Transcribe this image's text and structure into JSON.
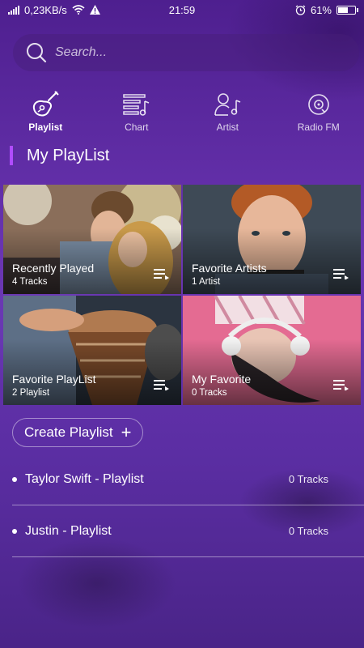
{
  "status_bar": {
    "speed": "0,23KB/s",
    "time": "21:59",
    "battery": "61%",
    "battery_level": 0.61
  },
  "search": {
    "placeholder": "Search..."
  },
  "tabs": [
    {
      "label": "Playlist",
      "icon": "guitar-icon",
      "active": true
    },
    {
      "label": "Chart",
      "icon": "chart-list-icon",
      "active": false
    },
    {
      "label": "Artist",
      "icon": "artist-icon",
      "active": false
    },
    {
      "label": "Radio FM",
      "icon": "radio-disc-icon",
      "active": false
    }
  ],
  "section": {
    "title": "My PlayList"
  },
  "cards": [
    {
      "title": "Recently Played",
      "subtitle": "4 Tracks"
    },
    {
      "title": "Favorite Artists",
      "subtitle": "1 Artist"
    },
    {
      "title": "Favorite PlayList",
      "subtitle": "2 Playlist"
    },
    {
      "title": "My Favorite",
      "subtitle": "0 Tracks"
    }
  ],
  "create_playlist": {
    "label": "Create Playlist"
  },
  "playlists": [
    {
      "name": "Taylor Swift - Playlist",
      "count": "0 Tracks"
    },
    {
      "name": "Justin - Playlist",
      "count": "0 Tracks"
    }
  ],
  "colors": {
    "accent": "#b14cff",
    "background": "#5a2aa0"
  }
}
